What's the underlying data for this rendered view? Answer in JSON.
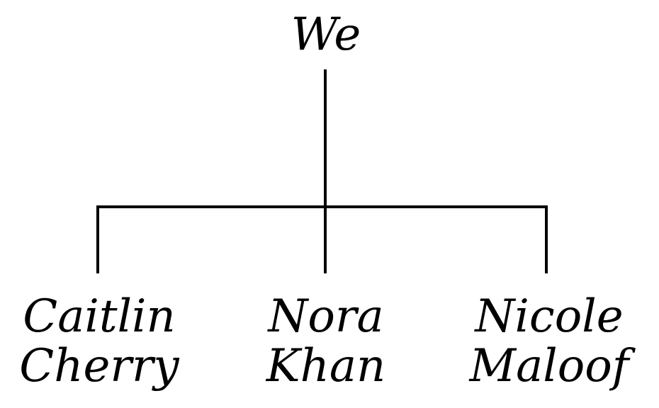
{
  "root": {
    "label": "We"
  },
  "children": [
    {
      "first": "Caitlin",
      "last": "Cherry"
    },
    {
      "first": "Nora",
      "last": "Khan"
    },
    {
      "first": "Nicole",
      "last": "Maloof"
    }
  ],
  "colors": {
    "line": "#000000",
    "text": "#000000",
    "background": "#ffffff"
  }
}
